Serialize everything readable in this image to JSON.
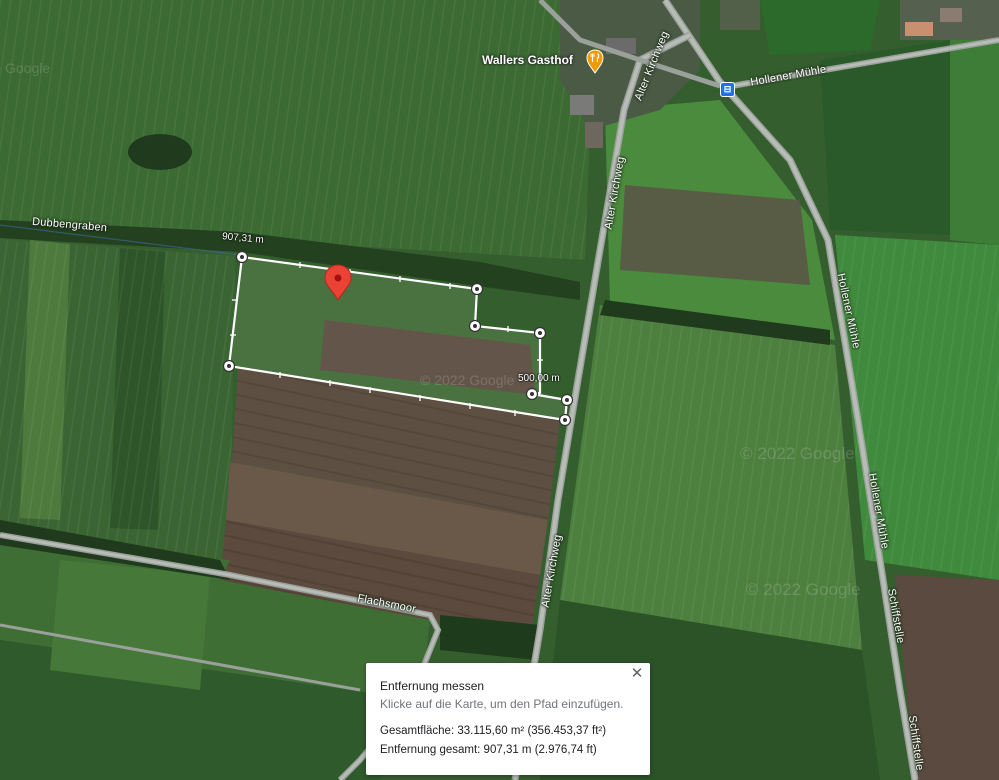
{
  "map": {
    "roads": [
      {
        "name": "Alter Kirchweg",
        "instance": "north"
      },
      {
        "name": "Alter Kirchweg",
        "instance": "middle"
      },
      {
        "name": "Alter Kirchweg",
        "instance": "south"
      },
      {
        "name": "Hollener Mühle",
        "instance": "east"
      },
      {
        "name": "Hollener Mühle",
        "instance": "right-vertical"
      },
      {
        "name": "Hollener Mühle",
        "instance": "right-lower"
      },
      {
        "name": "Schiffstelle",
        "instance": "upper"
      },
      {
        "name": "Schiffstelle",
        "instance": "lower"
      },
      {
        "name": "Flachsmoor",
        "instance": "main"
      },
      {
        "name": "Dubbengraben",
        "instance": "main"
      }
    ],
    "poi": {
      "name": "Wallers Gasthof",
      "icon": "restaurant-icon",
      "color": "#f29900"
    },
    "transit": {
      "icon": "bus-stop-icon"
    },
    "watermarks": [
      "© 2022 Google",
      "© 2022 Google",
      "© 2022 Google",
      "Google"
    ],
    "marker": {
      "icon": "map-pin-icon",
      "color": "#ea4335"
    },
    "measure_labels": {
      "top_left": "907,31 m",
      "right": "500,00 m"
    }
  },
  "panel": {
    "title": "Entfernung messen",
    "hint": "Klicke auf die Karte, um den Pfad einzufügen.",
    "area": "Gesamtfläche: 33.115,60 m² (356.453,37 ft²)",
    "distance": "Entfernung gesamt: 907,31 m (2.976,74 ft)",
    "close_icon": "close-icon"
  }
}
